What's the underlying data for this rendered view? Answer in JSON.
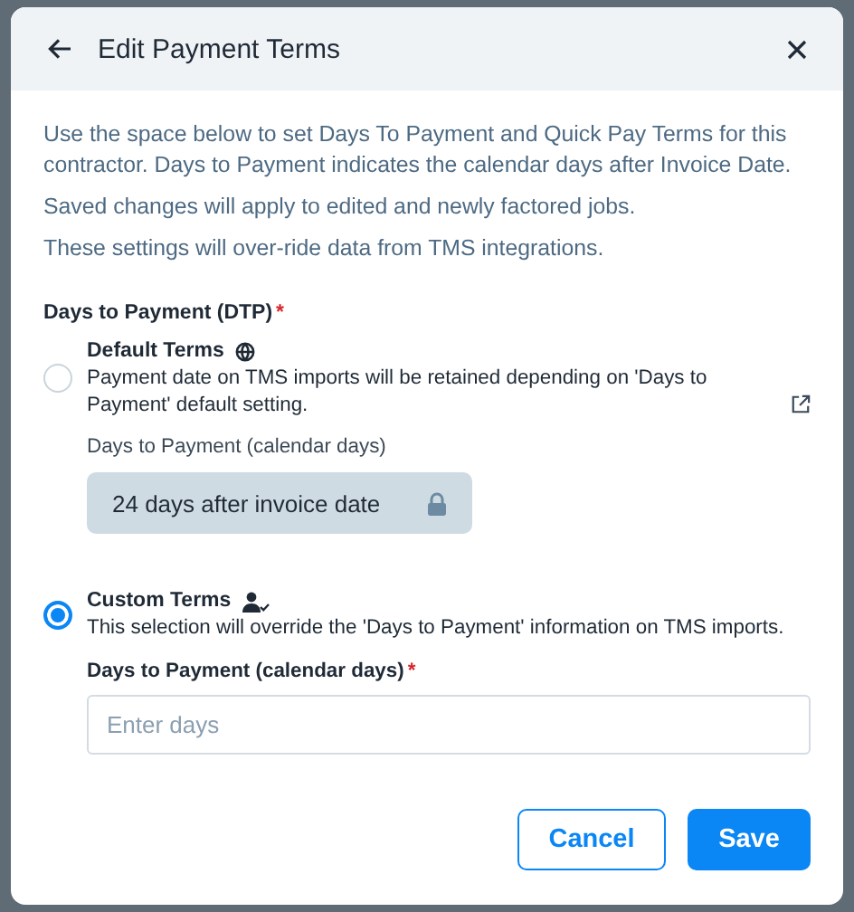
{
  "dialog": {
    "title": "Edit Payment Terms"
  },
  "intro": [
    "Use the space below to set Days To Payment and Quick Pay Terms for this contractor. Days to Payment indicates the calendar days after Invoice Date.",
    "Saved changes will apply to edited and newly factored jobs.",
    "These settings will over-ride data from TMS integrations."
  ],
  "section": {
    "label": "Days to Payment (DTP)",
    "required_mark": "*"
  },
  "options": [
    {
      "kind": "default",
      "title": "Default Terms",
      "description": "Payment date on TMS imports will be retained depending on 'Days to Payment' default setting.",
      "selected": false,
      "field": {
        "label": "Days to Payment (calendar days)",
        "value": "24 days after invoice date",
        "locked": true
      }
    },
    {
      "kind": "custom",
      "title": "Custom Terms",
      "description": "This selection will override the 'Days to Payment' information on TMS imports.",
      "selected": true,
      "field": {
        "label": "Days to Payment (calendar days)",
        "required_mark": "*",
        "placeholder": "Enter days"
      }
    }
  ],
  "buttons": [
    {
      "label": "Cancel",
      "kind": "secondary"
    },
    {
      "label": "Save",
      "kind": "primary"
    }
  ]
}
